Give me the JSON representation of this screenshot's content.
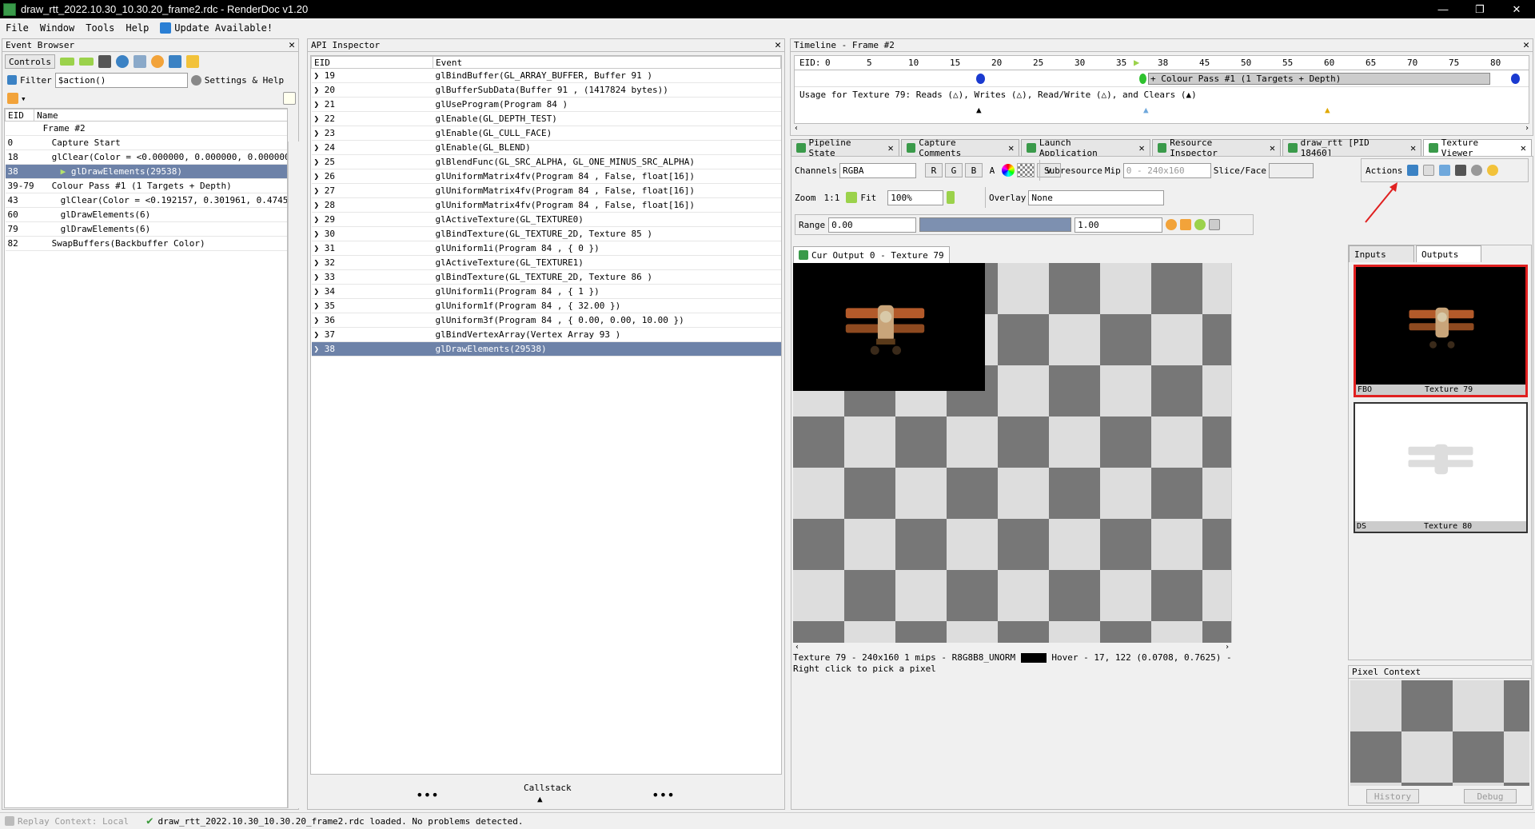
{
  "window": {
    "title": "draw_rtt_2022.10.30_10.30.20_frame2.rdc - RenderDoc v1.20"
  },
  "menu": {
    "file": "File",
    "window": "Window",
    "tools": "Tools",
    "help": "Help",
    "update": "Update Available!"
  },
  "event_browser": {
    "title": "Event Browser",
    "controls": "Controls",
    "filter_label": "Filter",
    "filter_value": "$action()",
    "settings": "Settings & Help",
    "col_eid": "EID",
    "col_name": "Name",
    "rows": [
      {
        "eid": "",
        "name": "Frame #2",
        "indent": 1
      },
      {
        "eid": "0",
        "name": "Capture Start",
        "indent": 2
      },
      {
        "eid": "18",
        "name": "glClear(Color = <0.000000, 0.000000, 0.000000⋯",
        "indent": 2
      },
      {
        "eid": "38",
        "name": "glDrawElements(29538)",
        "indent": 3,
        "selected": true
      },
      {
        "eid": "39-79",
        "name": "Colour Pass #1 (1 Targets + Depth)",
        "indent": 2
      },
      {
        "eid": "43",
        "name": "glClear(Color = <0.192157, 0.301961, 0.4745⋯",
        "indent": 3
      },
      {
        "eid": "60",
        "name": "glDrawElements(6)",
        "indent": 3
      },
      {
        "eid": "79",
        "name": "glDrawElements(6)",
        "indent": 3
      },
      {
        "eid": "82",
        "name": "SwapBuffers(Backbuffer Color)",
        "indent": 2
      }
    ]
  },
  "api_inspector": {
    "title": "API Inspector",
    "col_eid": "EID",
    "col_event": "Event",
    "callstack": "Callstack",
    "rows": [
      {
        "eid": "19",
        "event": "glBindBuffer(GL_ARRAY_BUFFER,  Buffer 91 )"
      },
      {
        "eid": "20",
        "event": "glBufferSubData(Buffer 91 ,  (1417824  bytes))"
      },
      {
        "eid": "21",
        "event": "glUseProgram(Program 84 )"
      },
      {
        "eid": "22",
        "event": "glEnable(GL_DEPTH_TEST)"
      },
      {
        "eid": "23",
        "event": "glEnable(GL_CULL_FACE)"
      },
      {
        "eid": "24",
        "event": "glEnable(GL_BLEND)"
      },
      {
        "eid": "25",
        "event": "glBlendFunc(GL_SRC_ALPHA, GL_ONE_MINUS_SRC_ALPHA)"
      },
      {
        "eid": "26",
        "event": "glUniformMatrix4fv(Program 84 ,  False,  float[16])"
      },
      {
        "eid": "27",
        "event": "glUniformMatrix4fv(Program 84 ,  False,  float[16])"
      },
      {
        "eid": "28",
        "event": "glUniformMatrix4fv(Program 84 ,  False,  float[16])"
      },
      {
        "eid": "29",
        "event": "glActiveTexture(GL_TEXTURE0)"
      },
      {
        "eid": "30",
        "event": "glBindTexture(GL_TEXTURE_2D,  Texture 85 )"
      },
      {
        "eid": "31",
        "event": "glUniform1i(Program 84 ,  { 0 })"
      },
      {
        "eid": "32",
        "event": "glActiveTexture(GL_TEXTURE1)"
      },
      {
        "eid": "33",
        "event": "glBindTexture(GL_TEXTURE_2D,  Texture 86 )"
      },
      {
        "eid": "34",
        "event": "glUniform1i(Program 84 ,  { 1 })"
      },
      {
        "eid": "35",
        "event": "glUniform1f(Program 84 ,  { 32.00 })"
      },
      {
        "eid": "36",
        "event": "glUniform3f(Program 84 ,  { 0.00,  0.00,  10.00 })"
      },
      {
        "eid": "37",
        "event": "glBindVertexArray(Vertex Array 93 )"
      },
      {
        "eid": "38",
        "event": "glDrawElements(29538)",
        "selected": true
      }
    ]
  },
  "timeline": {
    "title": "Timeline - Frame #2",
    "eid_label": "EID:",
    "ticks": [
      "0",
      "5",
      "10",
      "15",
      "20",
      "25",
      "30",
      "35",
      "38",
      "45",
      "50",
      "55",
      "60",
      "65",
      "70",
      "75",
      "80"
    ],
    "pass_label": "+ Colour Pass #1 (1 Targets + Depth)",
    "usage": "Usage for Texture 79: Reads (△), Writes (△), Read/Write (△), and Clears (▲)"
  },
  "tabs": [
    {
      "label": "Pipeline State"
    },
    {
      "label": "Capture Comments"
    },
    {
      "label": "Launch Application"
    },
    {
      "label": "Resource Inspector"
    },
    {
      "label": "draw_rtt [PID 18460]"
    },
    {
      "label": "Texture Viewer",
      "active": true
    }
  ],
  "texture_viewer": {
    "channels_label": "Channels",
    "channels_value": "RGBA",
    "r": "R",
    "g": "G",
    "b": "B",
    "a": "A",
    "subresource": "Subresource",
    "mip_label": "Mip",
    "mip_value": "0 - 240x160",
    "slice_label": "Slice/Face",
    "actions": "Actions",
    "zoom_label": "Zoom",
    "zoom_1to1": "1:1",
    "fit": "Fit",
    "zoom_value": "100%",
    "overlay_label": "Overlay",
    "overlay_value": "None",
    "range_label": "Range",
    "range_min": "0.00",
    "range_max": "1.00",
    "view_tab": "Cur Output 0 - Texture 79",
    "status_line1": "Texture 79 - 240x160 1 mips - R8G8B8_UNORM",
    "status_hover": "Hover -    17,  122 (0.0708, 0.7625)  -",
    "status_line2": "Right click to pick a pixel"
  },
  "outputs_panel": {
    "inputs_tab": "Inputs",
    "outputs_tab": "Outputs",
    "thumb1_left": "FBO",
    "thumb1_right": "Texture 79",
    "thumb2_left": "DS",
    "thumb2_right": "Texture 80",
    "pixel_context": "Pixel Context",
    "history": "History",
    "debug": "Debug"
  },
  "statusbar": {
    "replay": "Replay Context: Local",
    "message": "draw_rtt_2022.10.30_10.30.20_frame2.rdc loaded. No problems detected."
  },
  "colors": {
    "selection": "#6d82a8",
    "highlight_red": "#e02020",
    "accent_green": "#3a9a4a"
  }
}
